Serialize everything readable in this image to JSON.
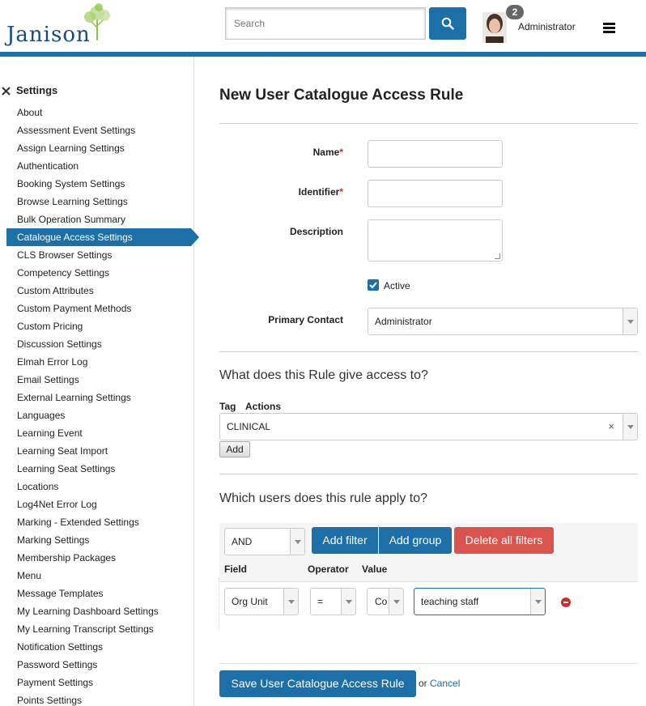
{
  "header": {
    "logo_text": "Janison",
    "search_placeholder": "Search",
    "notification_count": "2",
    "user_name": "Administrator"
  },
  "colors": {
    "primary": "#1d6fa8",
    "danger": "#d9534f",
    "required": "#c9302c"
  },
  "sidebar": {
    "title": "Settings",
    "items": [
      "About",
      "Assessment Event Settings",
      "Assign Learning Settings",
      "Authentication",
      "Booking System Settings",
      "Browse Learning Settings",
      "Bulk Operation Summary",
      "Catalogue Access Settings",
      "CLS Browser Settings",
      "Competency Settings",
      "Custom Attributes",
      "Custom Payment Methods",
      "Custom Pricing",
      "Discussion Settings",
      "Elmah Error Log",
      "Email Settings",
      "External Learning Settings",
      "Languages",
      "Learning Event",
      "Learning Seat Import",
      "Learning Seat Settings",
      "Locations",
      "Log4Net Error Log",
      "Marking - Extended Settings",
      "Marking Settings",
      "Membership Packages",
      "Menu",
      "Message Templates",
      "My Learning Dashboard Settings",
      "My Learning Transcript Settings",
      "Notification Settings",
      "Password Settings",
      "Payment Settings",
      "Points Settings"
    ],
    "active_item": "Catalogue Access Settings"
  },
  "form": {
    "title": "New User Catalogue Access Rule",
    "name_label": "Name",
    "identifier_label": "Identifier",
    "description_label": "Description",
    "required_mark": "*",
    "active_label": "Active",
    "active_checked": true,
    "primary_contact_label": "Primary Contact",
    "primary_contact_value": "Administrator"
  },
  "access_section": {
    "heading": "What does this Rule give access to?",
    "col_tag": "Tag",
    "col_actions": "Actions",
    "tag_value": "CLINICAL",
    "clear_symbol": "×",
    "add_label": "Add"
  },
  "users_section": {
    "heading": "Which users does this rule apply to?",
    "logic_value": "AND",
    "add_filter_label": "Add filter",
    "add_group_label": "Add group",
    "delete_all_label": "Delete all filters",
    "col_field": "Field",
    "col_operator": "Operator",
    "col_value": "Value",
    "filter": {
      "field": "Org Unit",
      "operator": "=",
      "value_type": "Co",
      "value": "teaching staff"
    }
  },
  "footer": {
    "save_label": "Save User Catalogue Access Rule",
    "or_text": "or",
    "cancel_label": "Cancel"
  }
}
